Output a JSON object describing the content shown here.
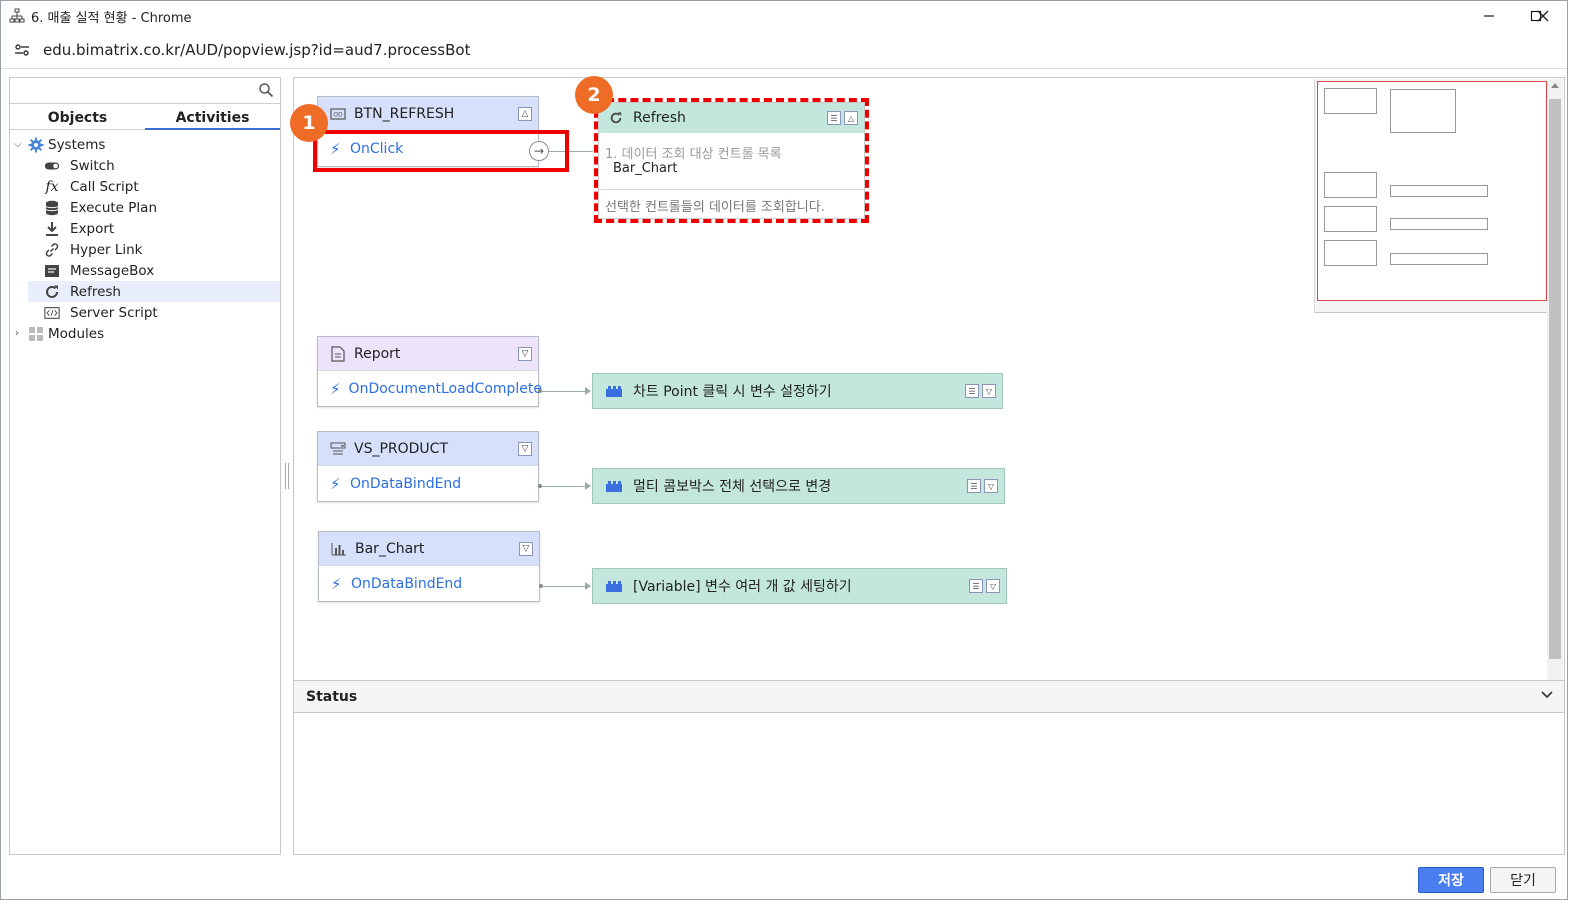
{
  "window": {
    "title": "6. 매출 실적 현황 - Chrome",
    "url": "edu.bimatrix.co.kr/AUD/popview.jsp?id=aud7.processBot"
  },
  "left_panel": {
    "search_placeholder": "",
    "tabs": [
      {
        "label": "Objects",
        "active": false
      },
      {
        "label": "Activities",
        "active": true
      }
    ],
    "tree": [
      {
        "label": "Systems",
        "icon": "gear-icon",
        "expanded": true,
        "level": 0
      },
      {
        "label": "Switch",
        "icon": "toggle-icon",
        "level": 1
      },
      {
        "label": "Call Script",
        "icon": "fx-icon",
        "level": 1
      },
      {
        "label": "Execute Plan",
        "icon": "database-icon",
        "level": 1
      },
      {
        "label": "Export",
        "icon": "download-icon",
        "level": 1
      },
      {
        "label": "Hyper Link",
        "icon": "link-icon",
        "level": 1
      },
      {
        "label": "MessageBox",
        "icon": "message-icon",
        "level": 1
      },
      {
        "label": "Refresh",
        "icon": "refresh-icon",
        "level": 1,
        "selected": true
      },
      {
        "label": "Server Script",
        "icon": "code-icon",
        "level": 1
      },
      {
        "label": "Modules",
        "icon": "grid-icon",
        "expanded": false,
        "level": 0
      }
    ]
  },
  "canvas": {
    "nodes": [
      {
        "name": "BTN_REFRESH",
        "event": "OnClick",
        "icon": "button-icon",
        "color": "#d6e0fb"
      },
      {
        "name": "Report",
        "event": "OnDocumentLoadComplete",
        "icon": "document-icon",
        "color": "#ede3fb"
      },
      {
        "name": "VS_PRODUCT",
        "event": "OnDataBindEnd",
        "icon": "combobox-icon",
        "color": "#d6e0fb"
      },
      {
        "name": "Bar_Chart",
        "event": "OnDataBindEnd",
        "icon": "bar-chart-icon",
        "color": "#d6e0fb"
      }
    ],
    "actions": [
      {
        "label": "차트 Point 클릭 시 변수 설정하기"
      },
      {
        "label": "멀티 콤보박스 전체 선택으로 변경"
      },
      {
        "label": "[Variable] 변수 여러 개 값 세팅하기"
      }
    ],
    "refresh_node": {
      "title": "Refresh",
      "param_label": "1. 데이터 조회 대상 컨트롤 목록",
      "param_value": "Bar_Chart",
      "description": "선택한 컨트롤들의 데이터를 조회합니다."
    },
    "badges": [
      "1",
      "2"
    ],
    "highlight_color": "#ee0000",
    "badge_color": "#ef6c27"
  },
  "status": {
    "label": "Status"
  },
  "footer": {
    "save_label": "저장",
    "close_label": "닫기"
  }
}
